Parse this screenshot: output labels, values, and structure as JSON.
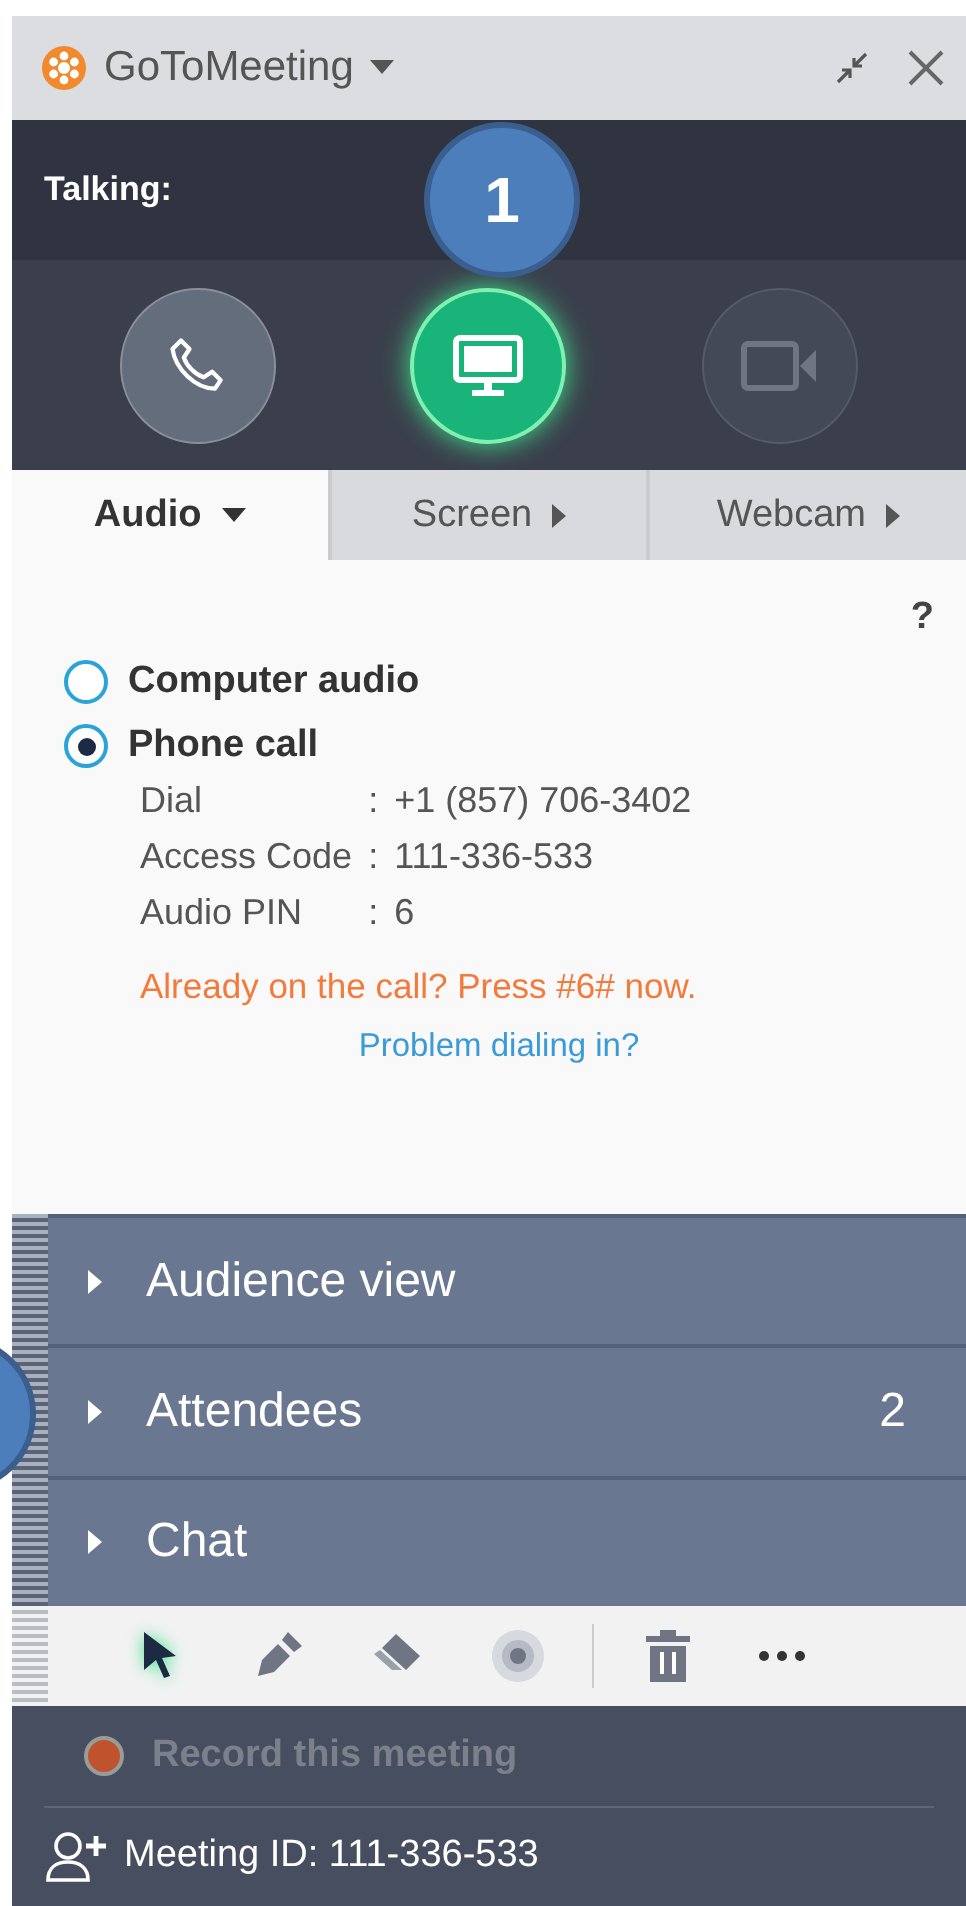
{
  "window": {
    "title": "GoToMeeting"
  },
  "talking": {
    "label": "Talking:"
  },
  "callout": {
    "label": "1"
  },
  "controls": [
    {
      "kind": "phone",
      "selected": false,
      "disabled": false
    },
    {
      "kind": "screen",
      "selected": true,
      "disabled": false
    },
    {
      "kind": "webcam",
      "selected": false,
      "disabled": true
    }
  ],
  "tabs": [
    {
      "label": "Audio",
      "selected": true
    },
    {
      "label": "Screen",
      "selected": false
    },
    {
      "label": "Webcam",
      "selected": false
    }
  ],
  "help": "?",
  "audio_options": [
    {
      "label": "Computer audio",
      "selected": false
    },
    {
      "label": "Phone call",
      "selected": true
    }
  ],
  "dial_info": [
    {
      "label": "Dial",
      "separator": ":",
      "value": "+1 (857) 706-3402"
    },
    {
      "label": "Access Code",
      "separator": ":",
      "value": "111-336-533"
    },
    {
      "label": "Audio PIN",
      "separator": ":",
      "value": "6"
    }
  ],
  "notice": "Already on the call? Press #6# now.",
  "help_link": "Problem dialing in?",
  "panels": [
    {
      "label": "Audience view",
      "expanded": false
    },
    {
      "label": "Attendees",
      "expanded": false,
      "count": "2"
    },
    {
      "label": "Chat",
      "expanded": false
    }
  ],
  "tools": [
    {
      "kind": "pointer",
      "selected": true
    },
    {
      "kind": "pen",
      "selected": false
    },
    {
      "kind": "eraser",
      "selected": false
    },
    {
      "kind": "spotlight",
      "selected": false
    },
    {
      "kind": "trash",
      "selected": false
    },
    {
      "kind": "more",
      "selected": false
    }
  ],
  "record": {
    "label": "Record this meeting",
    "disabled": true
  },
  "meeting_id": "Meeting ID: 111-336-533"
}
